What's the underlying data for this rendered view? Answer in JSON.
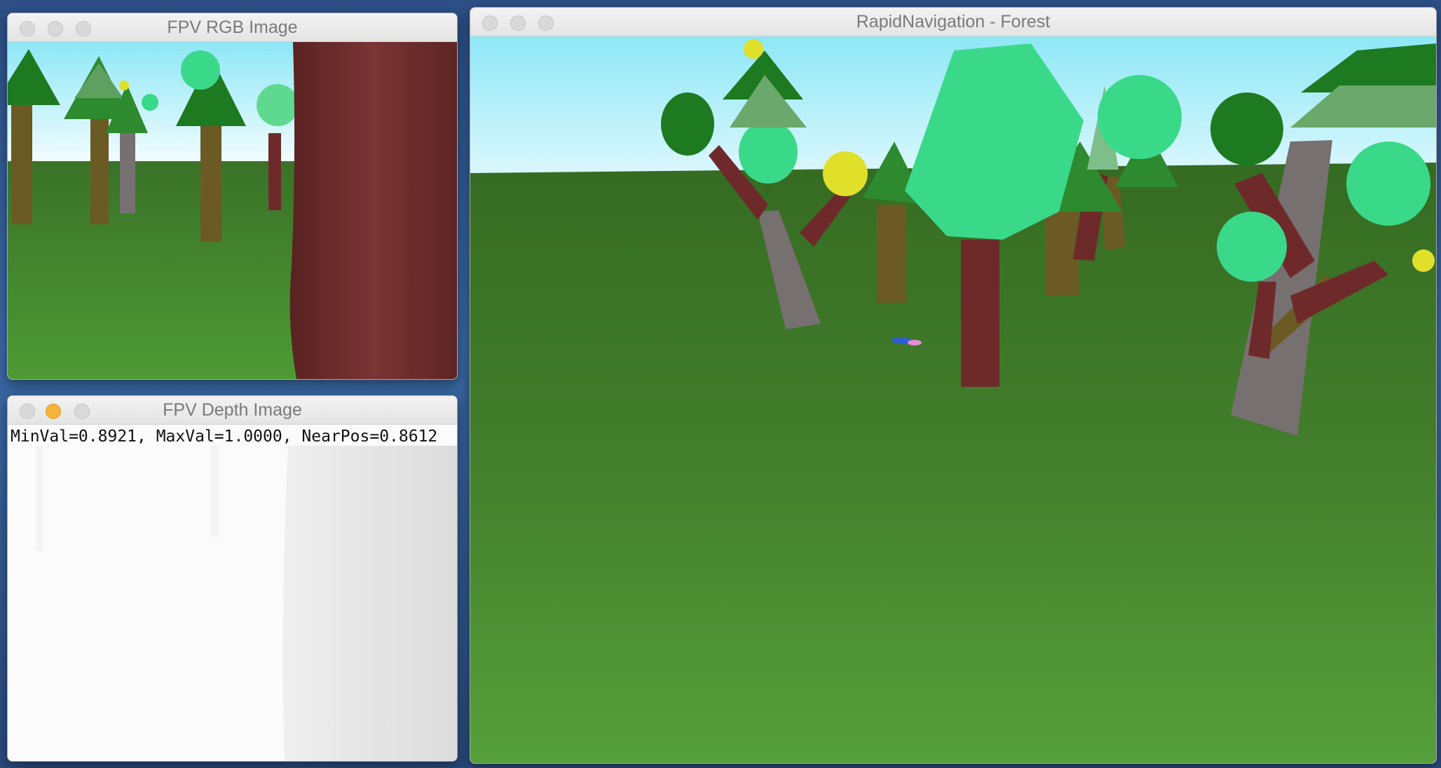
{
  "windows": {
    "rgb": {
      "title": "FPV RGB Image"
    },
    "depth": {
      "title": "FPV Depth Image",
      "overlay_text": "MinVal=0.8921, MaxVal=1.0000, NearPos=0.8612"
    },
    "main": {
      "title": "RapidNavigation - Forest"
    }
  },
  "colors": {
    "sky_top": "#8ee7f6",
    "sky_bottom": "#f4fdff",
    "grass": "#3f7d2a",
    "trunk_red": "#6e2a2a",
    "trunk_gray": "#777070",
    "trunk_olive": "#6b5a24",
    "foliage_dark": "#1e7a20",
    "foliage_light": "#3ad98a",
    "fruit_yellow": "#e0e02a"
  },
  "icons": [
    "close-button",
    "minimize-button",
    "zoom-button"
  ]
}
